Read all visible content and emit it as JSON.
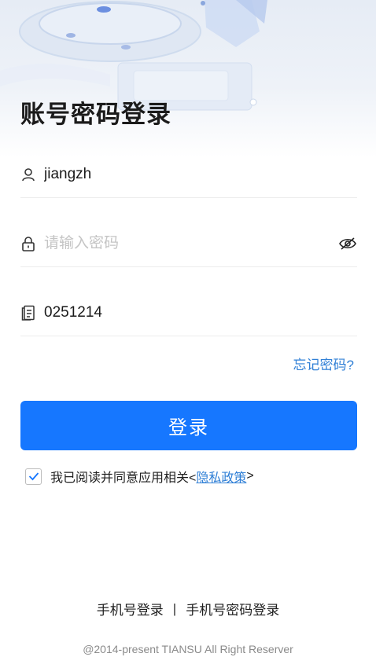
{
  "header": {
    "title": "账号密码登录"
  },
  "form": {
    "username": {
      "value": "jiangzh",
      "icon": "user-icon"
    },
    "password": {
      "value": "",
      "placeholder": "请输入密码",
      "icon": "lock-icon",
      "toggle_icon": "eye-off-icon"
    },
    "tenant": {
      "value": "0251214",
      "icon": "document-icon"
    },
    "forgot_label": "忘记密码?",
    "submit_label": "登录"
  },
  "agreement": {
    "checked": true,
    "text": "我已阅读并同意应用相关<",
    "link_label": "隐私政策",
    "suffix": ">"
  },
  "footer": {
    "phone_login": "手机号登录",
    "separator": "|",
    "phone_password_login": "手机号密码登录",
    "copyright": "@2014-present TIANSU All Right Reserver"
  },
  "colors": {
    "primary": "#1677ff",
    "link": "#2f7fd6",
    "placeholder": "#c4c4c4"
  }
}
